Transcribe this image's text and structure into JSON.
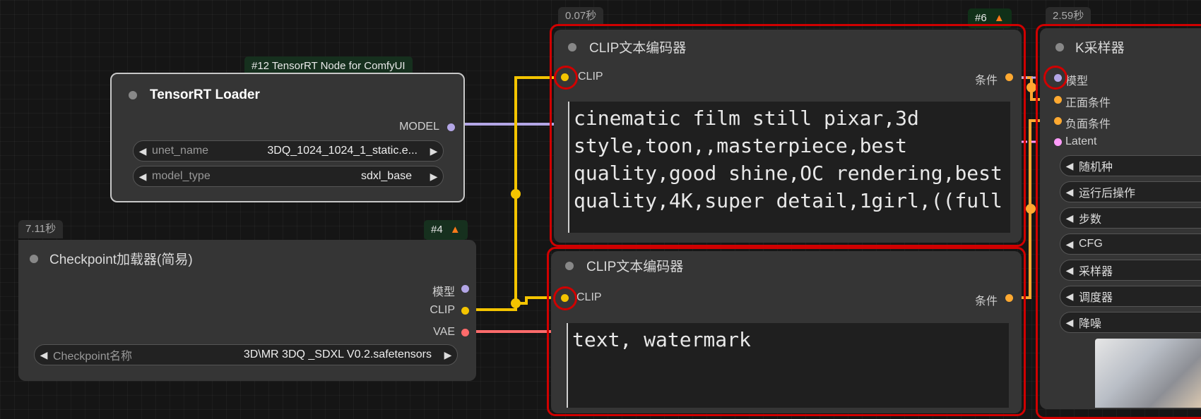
{
  "nodes": {
    "tensorrt": {
      "badge": "#12 TensorRT Node for ComfyUI",
      "title": "TensorRT Loader",
      "output_label": "MODEL",
      "widgets": [
        {
          "name": "unet_name",
          "value": "3DQ_1024_1024_1_static.e..."
        },
        {
          "name": "model_type",
          "value": "sdxl_base"
        }
      ]
    },
    "checkpoint": {
      "timer": "7.11秒",
      "badge": "#4",
      "badge_icon": "fox-icon",
      "title": "Checkpoint加载器(简易)",
      "outputs": [
        "模型",
        "CLIP",
        "VAE"
      ],
      "widget": {
        "name": "Checkpoint名称",
        "value": "3D\\MR 3DQ _SDXL V0.2.safetensors"
      }
    },
    "clip_pos": {
      "timer": "0.07秒",
      "badge": "#6",
      "badge_icon": "fox-icon",
      "title": "CLIP文本编码器",
      "input_label": "CLIP",
      "output_label": "条件",
      "text": "cinematic film still pixar,3d style,toon,,masterpiece,best quality,good shine,OC rendering,best quality,4K,super detail,1girl,((full"
    },
    "clip_neg": {
      "title": "CLIP文本编码器",
      "input_label": "CLIP",
      "output_label": "条件",
      "text": "text, watermark"
    },
    "ksampler": {
      "timer": "2.59秒",
      "title": "K采样器",
      "inputs": [
        "模型",
        "正面条件",
        "负面条件",
        "Latent"
      ],
      "widgets": [
        "随机种",
        "运行后操作",
        "步数",
        "CFG",
        "采样器",
        "调度器",
        "降噪"
      ]
    }
  },
  "colors": {
    "model": "#b3a6e6",
    "clip": "#f4c400",
    "vae": "#ff6b6b",
    "conditioning": "#ffa931",
    "latent": "#ff9cf9",
    "executing": "#d00000"
  }
}
